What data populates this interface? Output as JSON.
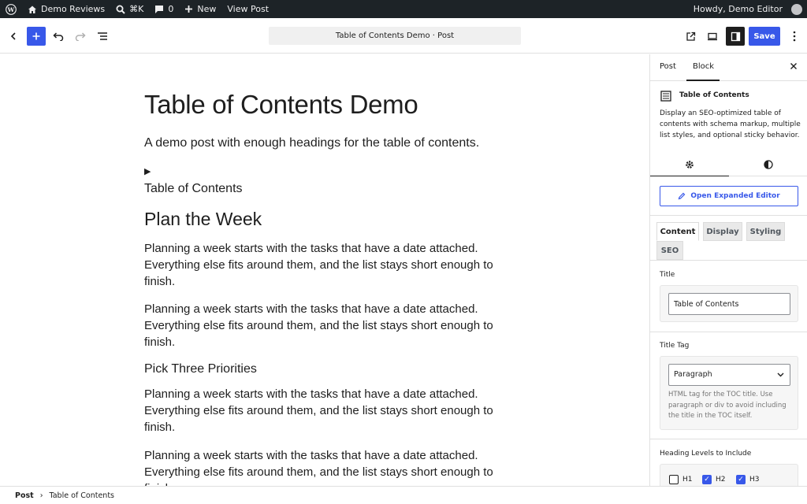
{
  "admin_bar": {
    "site_name": "Demo Reviews",
    "search_shortcut": "⌘K",
    "comments_count": "0",
    "new_label": "New",
    "view_post_label": "View Post",
    "greeting": "Howdy, Demo Editor"
  },
  "header": {
    "doc_title": "Table of Contents Demo · Post",
    "save_label": "Save"
  },
  "canvas": {
    "title": "Table of Contents Demo",
    "excerpt": "A demo post with enough headings for the table of contents.",
    "toc_toggle": "▶",
    "toc_title": "Table of Contents",
    "h2": "Plan the Week",
    "paragraph": "Planning a week starts with the tasks that have a date attached. Everything else fits around them, and the list stays short enough to finish.",
    "h3": "Pick Three Priorities"
  },
  "sidebar": {
    "tabs": [
      "Post",
      "Block"
    ],
    "block_name": "Table of Contents",
    "block_description": "Display an SEO-optimized table of contents with schema markup, multiple list styles, and optional sticky behavior.",
    "expand_button": "Open Expanded Editor",
    "content_tabs": [
      "Content",
      "Display",
      "Styling",
      "SEO"
    ],
    "title_label": "Title",
    "title_value": "Table of Contents",
    "title_tag_label": "Title Tag",
    "title_tag_value": "Paragraph",
    "title_tag_help": "HTML tag for the TOC title. Use paragraph or div to avoid including the title in the TOC itself.",
    "heading_levels_label": "Heading Levels to Include",
    "heading_levels": [
      {
        "label": "H1",
        "checked": false
      },
      {
        "label": "H2",
        "checked": true
      },
      {
        "label": "H3",
        "checked": true
      }
    ]
  },
  "footer": {
    "crumbs": [
      "Post",
      "Table of Contents"
    ],
    "separator": "›"
  },
  "colors": {
    "accent": "#3858e9",
    "admin_bar": "#1d2327"
  }
}
